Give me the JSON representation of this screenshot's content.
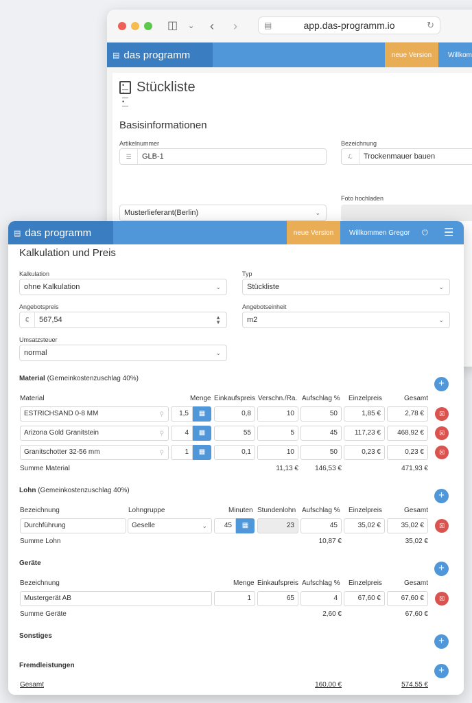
{
  "browser": {
    "url": "app.das-programm.io"
  },
  "appbar": {
    "brand": "das programm",
    "new_version": "neue Version",
    "welcome": "Willkommen Gregor",
    "welcome_truncated": "Willkomm"
  },
  "background_page": {
    "title": "Stückliste",
    "section": "Basisinformationen",
    "artikelnummer_label": "Artikelnummer",
    "artikelnummer_value": "GLB-1",
    "bezeichnung_label": "Bezeichnung",
    "bezeichnung_value": "Trockenmauer bauen",
    "lieferant_value": "Musterlieferant(Berlin)",
    "foto_label": "Foto hochladen"
  },
  "calc": {
    "title": "Kalkulation und Preis",
    "kalkulation_label": "Kalkulation",
    "kalkulation_value": "ohne Kalkulation",
    "typ_label": "Typ",
    "typ_value": "Stückliste",
    "angebotspreis_label": "Angebotspreis",
    "currency": "€",
    "angebotspreis_value": "567,54",
    "angebotseinheit_label": "Angebotseinheit",
    "angebotseinheit_value": "m2",
    "ust_label": "Umsatzsteuer",
    "ust_value": "normal"
  },
  "material": {
    "heading": "Material",
    "note": "(Gemeinkostenzuschlag 40%)",
    "headers": [
      "Material",
      "Menge",
      "Einkaufspreis",
      "Verschn./Ra.",
      "Aufschlag %",
      "Einzelpreis",
      "Gesamt"
    ],
    "rows": [
      {
        "name": "ESTRICHSAND 0-8 MM",
        "menge": "1,5",
        "ek": "0,8",
        "verschnitt": "10",
        "aufschlag": "50",
        "einzel": "1,85 €",
        "gesamt": "2,78 €"
      },
      {
        "name": "Arizona Gold Granitstein",
        "menge": "4",
        "ek": "55",
        "verschnitt": "5",
        "aufschlag": "45",
        "einzel": "117,23 €",
        "gesamt": "468,92 €"
      },
      {
        "name": "Granitschotter 32-56 mm",
        "menge": "1",
        "ek": "0,1",
        "verschnitt": "10",
        "aufschlag": "50",
        "einzel": "0,23 €",
        "gesamt": "0,23 €"
      }
    ],
    "sum_label": "Summe Material",
    "sum_verschnitt": "11,13 €",
    "sum_aufschlag": "146,53 €",
    "sum_gesamt": "471,93 €"
  },
  "lohn": {
    "heading": "Lohn",
    "note": "(Gemeinkostenzuschlag 40%)",
    "headers": [
      "Bezeichnung",
      "Lohngruppe",
      "Minuten",
      "Stundenlohn",
      "Aufschlag %",
      "Einzelpreis",
      "Gesamt"
    ],
    "rows": [
      {
        "name": "Durchführung",
        "gruppe": "Geselle",
        "minuten": "45",
        "stundenlohn": "23",
        "aufschlag": "45",
        "einzel": "35,02 €",
        "gesamt": "35,02 €"
      }
    ],
    "sum_label": "Summe Lohn",
    "sum_aufschlag": "10,87 €",
    "sum_gesamt": "35,02 €"
  },
  "geraete": {
    "heading": "Geräte",
    "headers": [
      "Bezeichnung",
      "Menge",
      "Einkaufspreis",
      "Aufschlag %",
      "Einzelpreis",
      "Gesamt"
    ],
    "rows": [
      {
        "name": "Mustergerät AB",
        "menge": "1",
        "ek": "65",
        "aufschlag": "4",
        "einzel": "67,60 €",
        "gesamt": "67,60 €"
      }
    ],
    "sum_label": "Summe Geräte",
    "sum_aufschlag": "2,60 €",
    "sum_gesamt": "67,60 €"
  },
  "sonstiges": {
    "heading": "Sonstiges"
  },
  "fremd": {
    "heading": "Fremdleistungen"
  },
  "total": {
    "label": "Gesamt",
    "aufschlag": "160,00 €",
    "gesamt": "574,55 €"
  },
  "colors": {
    "primary": "#4f97d9",
    "brand_dark": "#3a7dc0",
    "accent": "#e9ad55",
    "danger": "#d9534f"
  }
}
